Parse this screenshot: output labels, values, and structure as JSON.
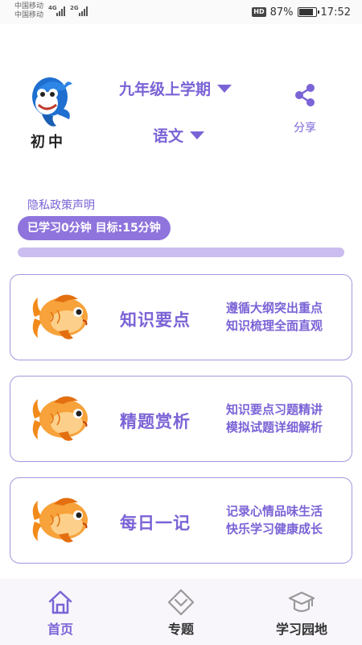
{
  "status_bar": {
    "carrier_1": "中国移动",
    "carrier_2": "中国移动",
    "network_1": "4G",
    "network_2": "2G",
    "hd_badge": "HD",
    "battery_text": "87%",
    "battery_level": 0.87,
    "time": "17:52"
  },
  "header": {
    "logo_text": "初中",
    "grade_select": "九年级上学期",
    "subject_select": "语文",
    "share_label": "分享"
  },
  "privacy_link": "隐私政策声明",
  "study": {
    "label": "已学习0分钟 目标:15分钟",
    "progress": 0
  },
  "cards": [
    {
      "title": "知识要点",
      "desc_line1": "遵循大纲突出重点",
      "desc_line2": "知识梳理全面直观",
      "icon": "goldfish-icon"
    },
    {
      "title": "精题赏析",
      "desc_line1": "知识要点习题精讲",
      "desc_line2": "模拟试题详细解析",
      "icon": "goldfish-icon"
    },
    {
      "title": "每日一记",
      "desc_line1": "记录心情品味生活",
      "desc_line2": "快乐学习健康成长",
      "icon": "goldfish-icon"
    }
  ],
  "bottom_nav": [
    {
      "label": "首页",
      "icon": "home-icon",
      "active": true
    },
    {
      "label": "专题",
      "icon": "diamond-icon",
      "active": false
    },
    {
      "label": "学习园地",
      "icon": "graduation-cap-icon",
      "active": false
    }
  ],
  "colors": {
    "accent": "#7b63d6",
    "pill": "#8e74dc",
    "track": "#cbbdf0",
    "card_border": "#a796dc"
  }
}
